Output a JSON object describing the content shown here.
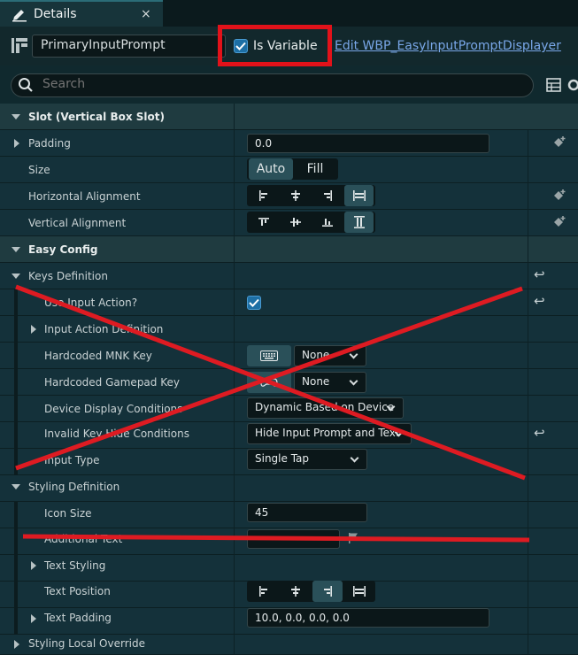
{
  "tab": {
    "title": "Details",
    "close": "×"
  },
  "header": {
    "object_name": "PrimaryInputPrompt",
    "is_variable_label": "Is Variable",
    "edit_link": "Edit WBP_EasyInputPromptDisplayer"
  },
  "search": {
    "placeholder": "Search"
  },
  "rows": {
    "slot": "Slot (Vertical Box Slot)",
    "padding": "Padding",
    "padding_value": "0.0",
    "size": "Size",
    "size_auto": "Auto",
    "size_fill": "Fill",
    "halign": "Horizontal Alignment",
    "valign": "Vertical Alignment",
    "easy_config": "Easy Config",
    "keys_def": "Keys Definition",
    "use_input_action": "Use Input Action?",
    "input_action_def": "Input Action Definition",
    "mnk_key": "Hardcoded MNK Key",
    "mnk_value": "None",
    "gamepad_key": "Hardcoded Gamepad Key",
    "gamepad_value": "None",
    "device_cond": "Device Display Conditions",
    "device_cond_value": "Dynamic Based on Device",
    "invalid_key": "Invalid Key Hide Conditions",
    "invalid_key_value": "Hide Input Prompt and Text",
    "input_type": "Input Type",
    "input_type_value": "Single Tap",
    "styling_def": "Styling Definition",
    "icon_size": "Icon Size",
    "icon_size_value": "45",
    "additional_text": "Additional Text",
    "additional_text_value": "",
    "text_styling": "Text Styling",
    "text_position": "Text Position",
    "text_padding": "Text Padding",
    "text_padding_value": "10.0, 0.0, 0.0, 0.0",
    "styling_local": "Styling Local Override"
  },
  "icons": [
    "pencil-icon",
    "close-icon",
    "widget-icon",
    "checkmark-icon",
    "search-icon",
    "grid-view-icon",
    "settings-icon",
    "expand-arrow-icon",
    "add-keyframe-icon",
    "reset-arrow-icon",
    "keyboard-icon",
    "gamepad-icon",
    "flag-icon"
  ],
  "colors": {
    "annotation_red": "#e2121a",
    "checkbox_blue": "#1d6fa5",
    "link_blue": "#79a7e8",
    "panel_bg": "#14313a"
  }
}
